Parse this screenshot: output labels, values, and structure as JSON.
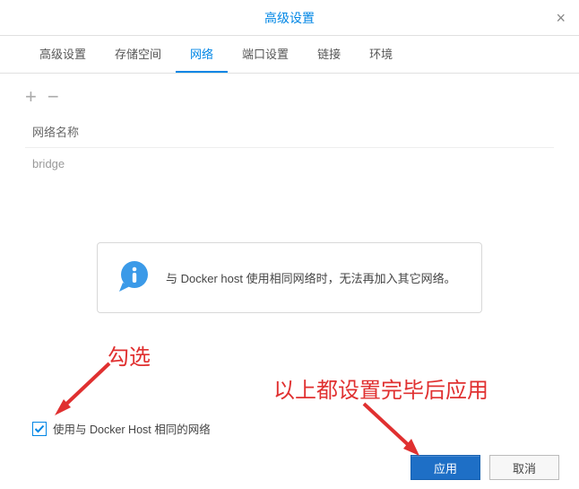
{
  "header": {
    "title": "高级设置"
  },
  "tabs": [
    {
      "label": "高级设置"
    },
    {
      "label": "存储空间"
    },
    {
      "label": "网络"
    },
    {
      "label": "端口设置"
    },
    {
      "label": "链接"
    },
    {
      "label": "环境"
    }
  ],
  "table": {
    "header": "网络名称",
    "rows": [
      {
        "name": "bridge"
      }
    ]
  },
  "info": {
    "text": "与 Docker host 使用相同网络时，无法再加入其它网络。"
  },
  "checkbox": {
    "label": "使用与 Docker Host 相同的网络",
    "checked": true
  },
  "buttons": {
    "apply": "应用",
    "cancel": "取消"
  },
  "annotations": {
    "check_hint": "勾选",
    "apply_hint": "以上都设置完毕后应用"
  }
}
